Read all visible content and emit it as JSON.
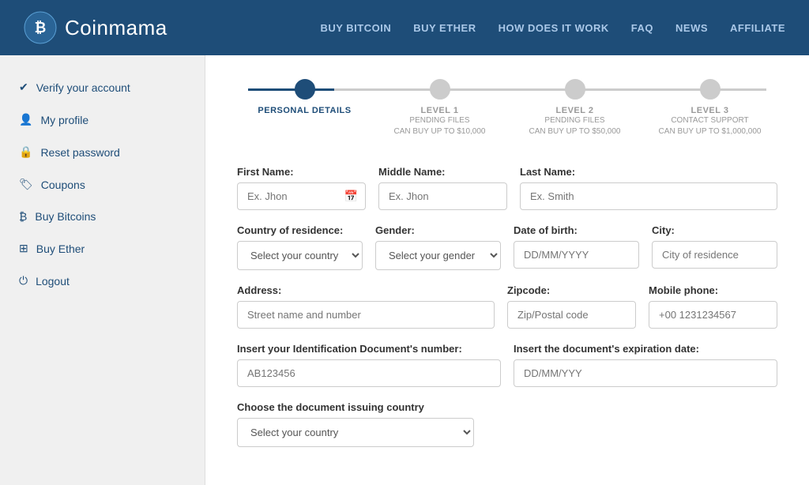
{
  "header": {
    "logo_bold": "Coin",
    "logo_light": "mama",
    "nav": [
      {
        "label": "BUY BITCOIN",
        "key": "buy-bitcoin"
      },
      {
        "label": "BUY ETHER",
        "key": "buy-ether"
      },
      {
        "label": "HOW DOES IT WORK",
        "key": "how-does-it-work"
      },
      {
        "label": "FAQ",
        "key": "faq"
      },
      {
        "label": "NEWS",
        "key": "news"
      },
      {
        "label": "AFFILIATE",
        "key": "affiliate"
      }
    ]
  },
  "sidebar": {
    "items": [
      {
        "label": "Verify your account",
        "icon": "✔",
        "key": "verify-account"
      },
      {
        "label": "My profile",
        "icon": "👤",
        "key": "my-profile"
      },
      {
        "label": "Reset password",
        "icon": "🔒",
        "key": "reset-password"
      },
      {
        "label": "Coupons",
        "icon": "🏷",
        "key": "coupons"
      },
      {
        "label": "Buy Bitcoins",
        "icon": "₿",
        "key": "buy-bitcoins"
      },
      {
        "label": "Buy Ether",
        "icon": "⊞",
        "key": "buy-ether"
      },
      {
        "label": "Logout",
        "icon": "⏻",
        "key": "logout"
      }
    ]
  },
  "progress": {
    "steps": [
      {
        "label": "PERSONAL DETAILS",
        "sublabel": "",
        "sublabel2": "",
        "active": true
      },
      {
        "label": "LEVEL 1",
        "sublabel": "PENDING FILES",
        "sublabel2": "CAN BUY UP TO $10,000",
        "active": false
      },
      {
        "label": "LEVEL 2",
        "sublabel": "PENDING FILES",
        "sublabel2": "CAN BUY UP TO $50,000",
        "active": false
      },
      {
        "label": "LEVEL 3",
        "sublabel": "CONTACT SUPPORT",
        "sublabel2": "CAN BUY UP TO $1,000,000",
        "active": false
      }
    ]
  },
  "form": {
    "first_name_label": "First Name:",
    "first_name_placeholder": "Ex. Jhon",
    "middle_name_label": "Middle Name:",
    "middle_name_placeholder": "Ex. Jhon",
    "last_name_label": "Last Name:",
    "last_name_placeholder": "Ex. Smith",
    "country_label": "Country of residence:",
    "country_placeholder": "Select your country",
    "gender_label": "Gender:",
    "gender_placeholder": "Select your gender",
    "dob_label": "Date of birth:",
    "dob_placeholder": "DD/MM/YYYY",
    "city_label": "City:",
    "city_placeholder": "City of residence",
    "address_label": "Address:",
    "address_placeholder": "Street name and number",
    "zipcode_label": "Zipcode:",
    "zipcode_placeholder": "Zip/Postal code",
    "mobile_label": "Mobile phone:",
    "mobile_placeholder": "+00 1231234567",
    "id_doc_label": "Insert your Identification Document's number:",
    "id_doc_placeholder": "AB123456",
    "id_expiry_label": "Insert the document's expiration date:",
    "id_expiry_placeholder": "DD/MM/YYY",
    "issuing_country_label": "Choose the document issuing country",
    "issuing_country_placeholder": "Select your country"
  }
}
